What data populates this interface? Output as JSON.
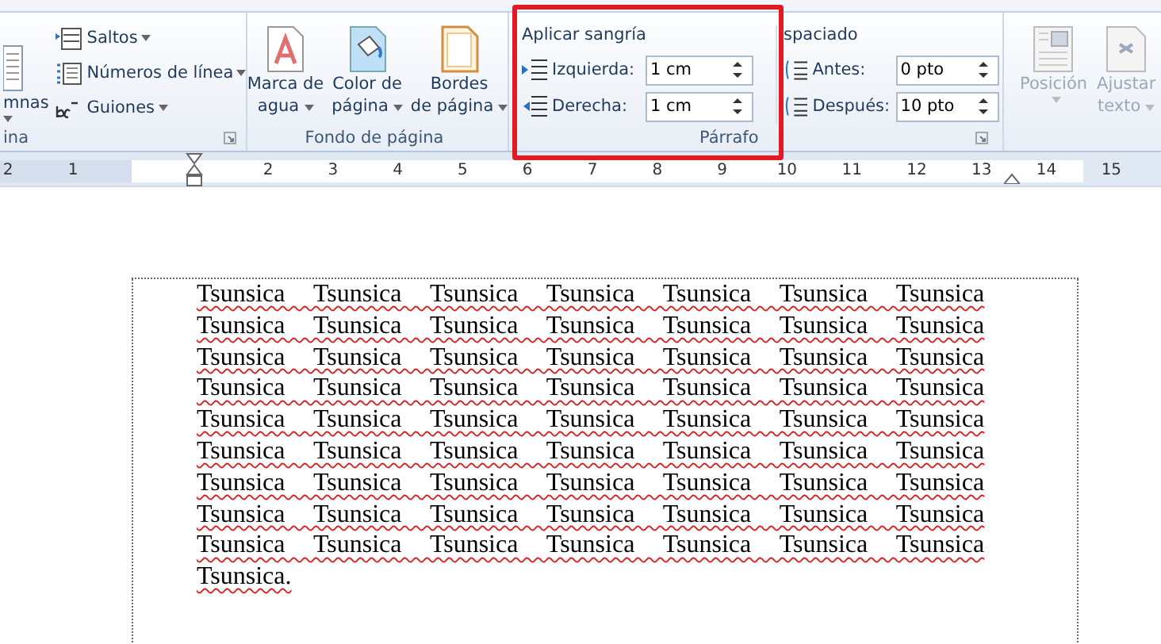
{
  "ribbon": {
    "groups": [
      {
        "kind": "page-setup",
        "label": "ina",
        "big_button": {
          "label": "mnas"
        },
        "items": [
          {
            "label": "Saltos"
          },
          {
            "label": "Números de línea"
          },
          {
            "label": "Guiones"
          }
        ]
      },
      {
        "kind": "background",
        "label": "Fondo de página",
        "buttons": [
          {
            "line1": "Marca de",
            "line2": "agua"
          },
          {
            "line1": "Color de",
            "line2": "página"
          },
          {
            "line1": "Bordes",
            "line2": "de página"
          }
        ]
      },
      {
        "kind": "paragraph",
        "label": "Párrafo",
        "highlighted": true,
        "indent": {
          "title": "Aplicar sangría",
          "fields": [
            {
              "label": "Izquierda:",
              "value": "1 cm"
            },
            {
              "label": "Derecha:",
              "value": "1 cm"
            }
          ]
        },
        "spacing": {
          "title": "spaciado",
          "fields": [
            {
              "label": "Antes:",
              "value": "0 pto"
            },
            {
              "label": "Después:",
              "value": "10 pto"
            }
          ]
        }
      },
      {
        "kind": "arrange",
        "buttons": [
          {
            "line1": "Posición",
            "disabled": true
          },
          {
            "line1": "Ajustar",
            "line2": "texto",
            "disabled": true
          }
        ]
      }
    ]
  },
  "ruler": {
    "left_numbers": [
      "2",
      "1"
    ],
    "right_numbers": [
      "2",
      "3",
      "4",
      "5",
      "6",
      "7",
      "8",
      "9",
      "10",
      "11",
      "12",
      "13",
      "14",
      "15"
    ]
  },
  "document": {
    "text": "Tsunsica Tsunsica Tsunsica Tsunsica Tsunsica Tsunsica Tsunsica Tsunsica Tsunsica Tsunsica Tsunsica Tsunsica Tsunsica Tsunsica Tsunsica Tsunsica Tsunsica Tsunsica Tsunsica Tsunsica Tsunsica Tsunsica Tsunsica Tsunsica Tsunsica Tsunsica Tsunsica Tsunsica Tsunsica Tsunsica Tsunsica Tsunsica Tsunsica Tsunsica Tsunsica Tsunsica Tsunsica Tsunsica Tsunsica Tsunsica Tsunsica Tsunsica Tsunsica Tsunsica Tsunsica Tsunsica Tsunsica Tsunsica Tsunsica Tsunsica Tsunsica Tsunsica Tsunsica Tsunsica Tsunsica Tsunsica Tsunsica Tsunsica Tsunsica Tsunsica Tsunsica Tsunsica Tsunsica Tsunsica.",
    "spellcheck": true
  }
}
